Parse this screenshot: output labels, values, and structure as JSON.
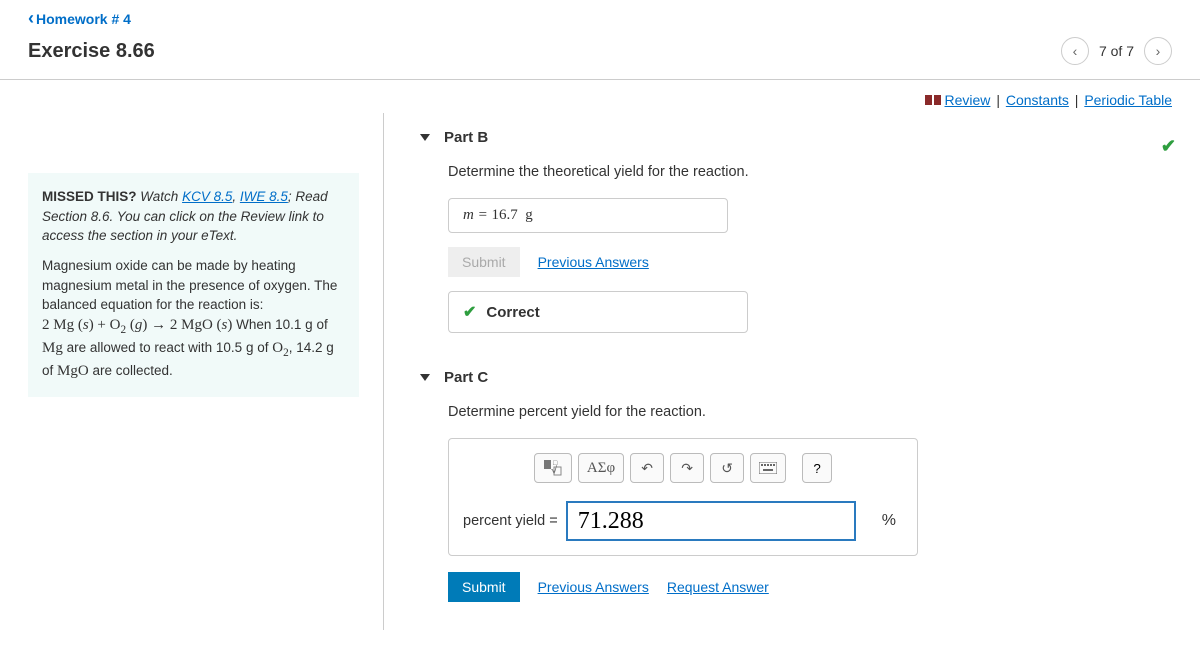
{
  "header": {
    "back_label": "Homework # 4",
    "title": "Exercise 8.66",
    "nav_count": "7 of 7"
  },
  "top_links": {
    "review": "Review",
    "constants": "Constants",
    "periodic": "Periodic Table"
  },
  "missed": {
    "title": "MISSED THIS?",
    "watch": "Watch",
    "link1": "KCV 8.5",
    "link2": "IWE 8.5",
    "read_tail": "; Read Section 8.6. You can click on the Review link to access the section in your eText."
  },
  "problem": {
    "intro": "Magnesium oxide can be made by heating magnesium metal in the presence of oxygen. The balanced equation for the reaction is:",
    "after_eq": "When 10.1 g of Mg are allowed to react with 10.5 g of O₂, 14.2 g of MgO are collected."
  },
  "partB": {
    "label": "Part B",
    "prompt": "Determine the theoretical yield for the reaction.",
    "answer_prefix": "m = ",
    "answer_value": "16.7",
    "answer_unit": "g",
    "submit": "Submit",
    "prev": "Previous Answers",
    "feedback": "Correct"
  },
  "partC": {
    "label": "Part C",
    "prompt": "Determine percent yield for the reaction.",
    "input_label": "percent yield =",
    "input_value": "71.288",
    "unit": "%",
    "submit": "Submit",
    "prev": "Previous Answers",
    "request": "Request Answer",
    "greek": "ΑΣφ",
    "help": "?"
  }
}
